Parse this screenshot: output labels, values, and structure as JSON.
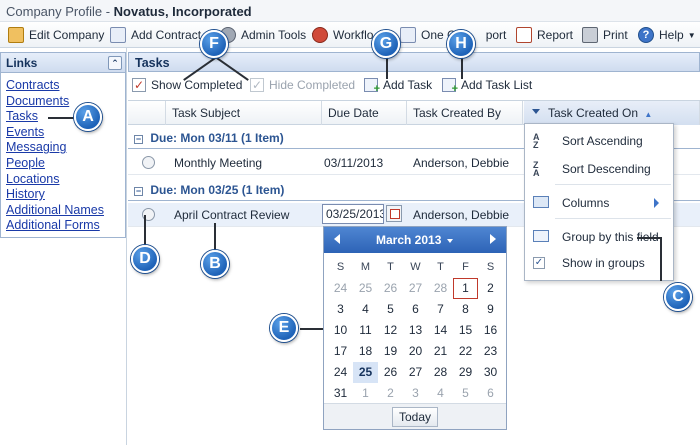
{
  "window": {
    "title_prefix": "Company Profile - ",
    "title_company": "Novatus, Incorporated"
  },
  "toolbar": {
    "edit_company": "Edit Company",
    "add_contract": "Add Contract",
    "admin_tools": "Admin Tools",
    "workflow": "Workflo",
    "one_click": "One C",
    "one_click_tail": "port",
    "report": "Report",
    "print": "Print",
    "help": "Help"
  },
  "links": {
    "title": "Links",
    "items": [
      "Contracts",
      "Documents",
      "Tasks",
      "Events",
      "Messaging",
      "People",
      "Locations",
      "History",
      "Additional Names",
      "Additional Forms"
    ]
  },
  "tasks": {
    "title": "Tasks",
    "show_completed": "Show Completed",
    "hide_completed": "Hide Completed",
    "add_task": "Add Task",
    "add_task_list": "Add Task List",
    "columns": [
      "Task Subject",
      "Due Date",
      "Task Created By",
      "Task Created On"
    ],
    "groups": [
      {
        "label": "Due: Mon 03/11 (1 Item)",
        "rows": [
          {
            "subject": "Monthly Meeting",
            "due": "03/11/2013",
            "created_by": "Anderson, Debbie"
          }
        ]
      },
      {
        "label": "Due: Mon 03/25 (1 Item)",
        "rows": [
          {
            "subject": "April Contract Review",
            "due": "03/25/2013",
            "created_by": "Anderson, Debbie"
          }
        ]
      }
    ]
  },
  "column_menu": {
    "sort_asc": "Sort Ascending",
    "sort_desc": "Sort Descending",
    "columns": "Columns",
    "group_by": "Group by this field",
    "show_in_groups": "Show in groups"
  },
  "calendar": {
    "month_label": "March 2013",
    "weekdays": [
      "S",
      "M",
      "T",
      "W",
      "T",
      "F",
      "S"
    ],
    "weeks": [
      [
        "24",
        "25",
        "26",
        "27",
        "28",
        "1",
        "2"
      ],
      [
        "3",
        "4",
        "5",
        "6",
        "7",
        "8",
        "9"
      ],
      [
        "10",
        "11",
        "12",
        "13",
        "14",
        "15",
        "16"
      ],
      [
        "17",
        "18",
        "19",
        "20",
        "21",
        "22",
        "23"
      ],
      [
        "24",
        "25",
        "26",
        "27",
        "28",
        "29",
        "30"
      ],
      [
        "31",
        "1",
        "2",
        "3",
        "4",
        "5",
        "6"
      ]
    ],
    "today_label": "Today"
  },
  "callouts": {
    "a": "A",
    "b": "B",
    "c": "C",
    "d": "D",
    "e": "E",
    "f": "F",
    "g": "G",
    "h": "H"
  },
  "colors": {
    "accent": "#1f63b8",
    "link": "#1a3aa8",
    "group_text": "#2c5592"
  }
}
